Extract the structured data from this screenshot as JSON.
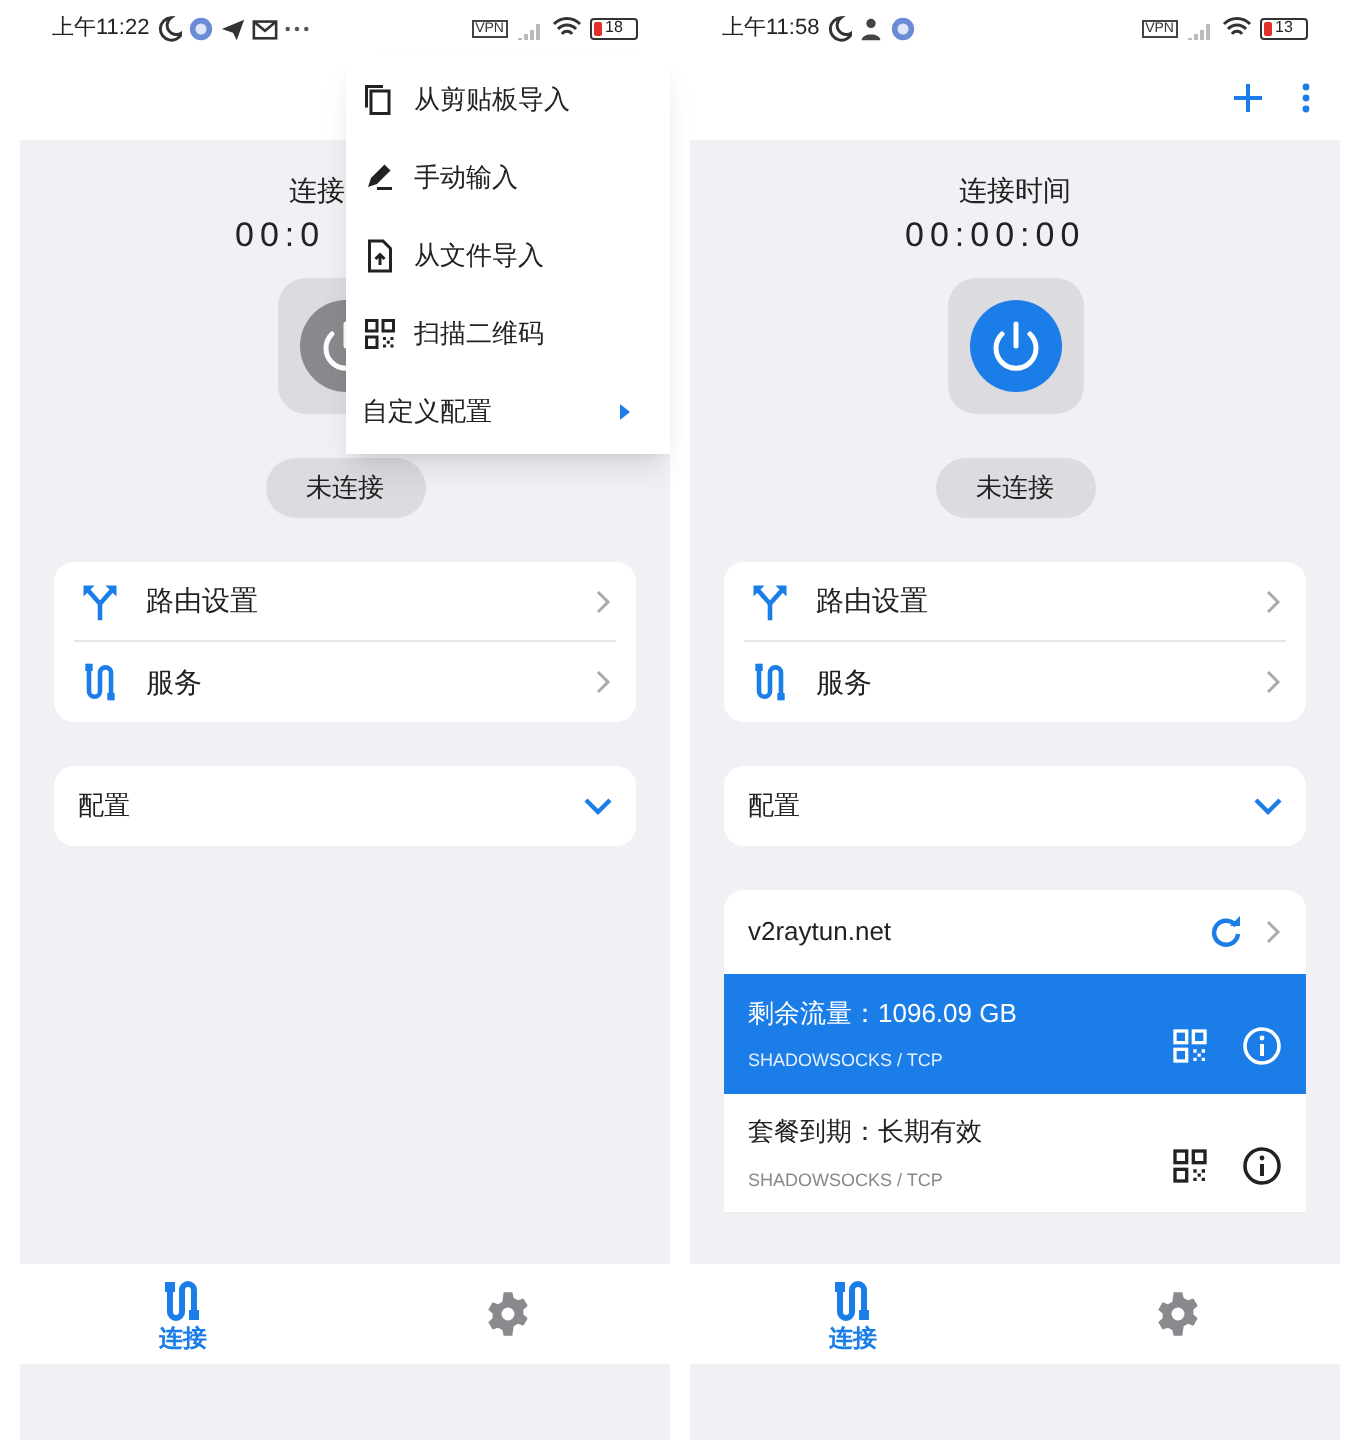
{
  "screens": [
    {
      "status_bar": {
        "time": "上午11:22",
        "vpn": "VPN",
        "battery": "18"
      },
      "connection": {
        "label": "连接",
        "timer": "00:0",
        "power_active": false,
        "status": "未连接"
      },
      "menu": [
        {
          "label": "路由设置"
        },
        {
          "label": "服务"
        }
      ],
      "config": {
        "label": "配置",
        "expanded": false
      },
      "popup_menu": [
        {
          "label": "从剪贴板导入",
          "submenu": false
        },
        {
          "label": "手动输入",
          "submenu": false
        },
        {
          "label": "从文件导入",
          "submenu": false
        },
        {
          "label": "扫描二维码",
          "submenu": false
        },
        {
          "label": "自定义配置",
          "submenu": true
        }
      ],
      "nav": [
        {
          "label": "连接",
          "selected": true
        },
        {
          "selected": false
        }
      ]
    },
    {
      "status_bar": {
        "time": "上午11:58",
        "vpn": "VPN",
        "battery": "13"
      },
      "connection": {
        "label": "连接时间",
        "timer": "00:00:00",
        "power_active": true,
        "status": "未连接"
      },
      "menu": [
        {
          "label": "路由设置"
        },
        {
          "label": "服务"
        }
      ],
      "config": {
        "label": "配置",
        "expanded": false
      },
      "subscription": {
        "name": "v2raytun.net",
        "items": [
          {
            "title": "剩余流量：1096.09 GB",
            "protocol": "SHADOWSOCKS / TCP",
            "selected": true
          },
          {
            "title": "套餐到期：长期有效",
            "protocol": "SHADOWSOCKS / TCP",
            "selected": false
          }
        ]
      },
      "nav": [
        {
          "label": "连接",
          "selected": true
        },
        {
          "selected": false
        }
      ]
    }
  ]
}
